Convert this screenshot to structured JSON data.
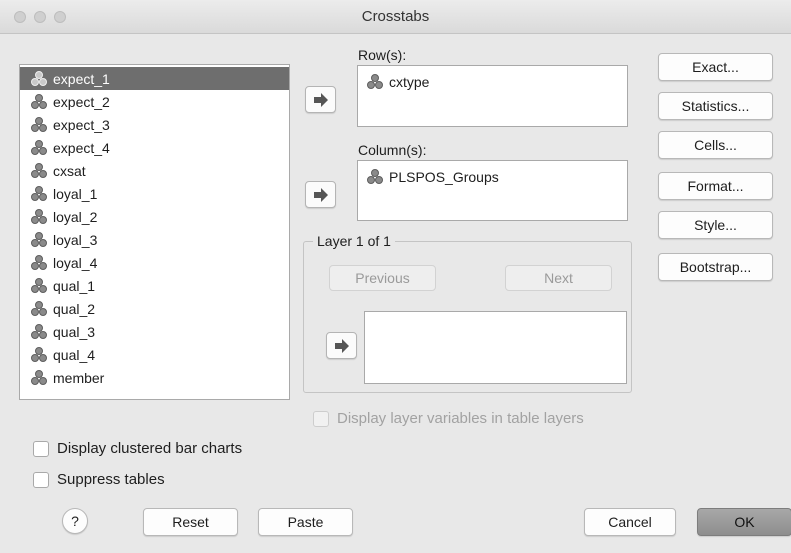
{
  "window": {
    "title": "Crosstabs"
  },
  "variables": [
    {
      "label": "expect_1",
      "selected": true
    },
    {
      "label": "expect_2"
    },
    {
      "label": "expect_3"
    },
    {
      "label": "expect_4"
    },
    {
      "label": "cxsat"
    },
    {
      "label": "loyal_1"
    },
    {
      "label": "loyal_2"
    },
    {
      "label": "loyal_3"
    },
    {
      "label": "loyal_4"
    },
    {
      "label": "qual_1"
    },
    {
      "label": "qual_2"
    },
    {
      "label": "qual_3"
    },
    {
      "label": "qual_4"
    },
    {
      "label": "member"
    }
  ],
  "rows": {
    "label": "Row(s):",
    "items": [
      "cxtype"
    ]
  },
  "columns": {
    "label": "Column(s):",
    "items": [
      "PLSPOS_Groups"
    ]
  },
  "layer": {
    "legend": "Layer 1 of 1",
    "previous_label": "Previous",
    "next_label": "Next"
  },
  "side_buttons": {
    "exact": "Exact...",
    "statistics": "Statistics...",
    "cells": "Cells...",
    "format": "Format...",
    "style": "Style...",
    "bootstrap": "Bootstrap..."
  },
  "options": {
    "display_layer_variables": "Display layer variables in table layers",
    "clustered_bar_charts": "Display clustered bar charts",
    "suppress_tables": "Suppress tables"
  },
  "footer": {
    "help": "?",
    "reset": "Reset",
    "paste": "Paste",
    "cancel": "Cancel",
    "ok": "OK"
  }
}
